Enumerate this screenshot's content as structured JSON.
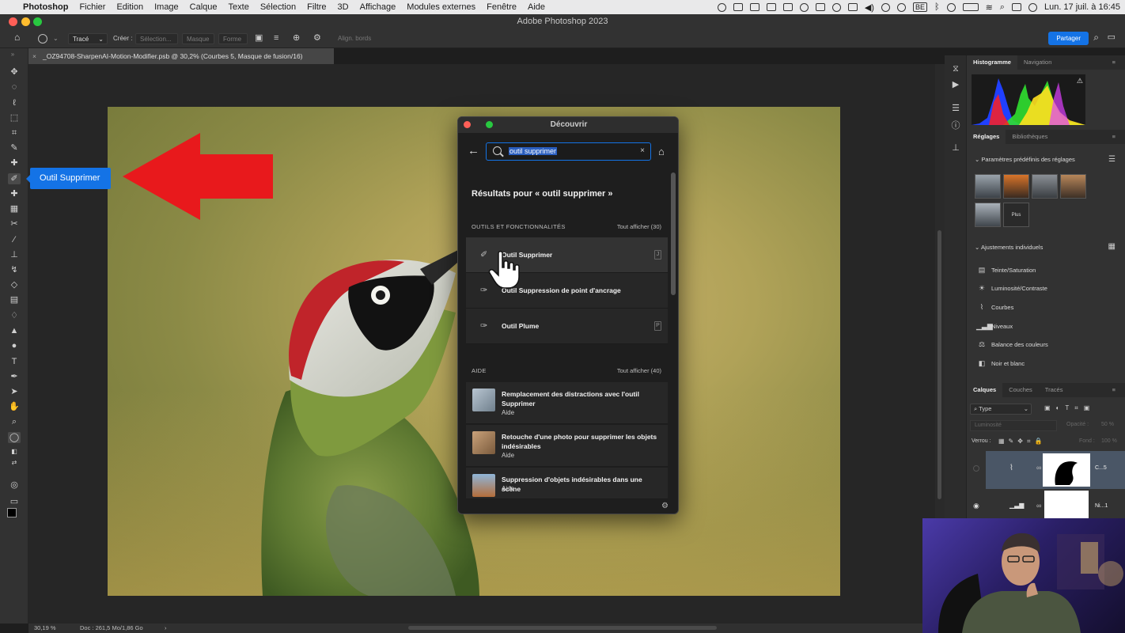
{
  "menubar": {
    "app": "Photoshop",
    "items": [
      "Fichier",
      "Edition",
      "Image",
      "Calque",
      "Texte",
      "Sélection",
      "Filtre",
      "3D",
      "Affichage",
      "Modules externes",
      "Fenêtre",
      "Aide"
    ],
    "lang_badge": "BE",
    "datetime": "Lun. 17 juil. à 16:45"
  },
  "window": {
    "title": "Adobe Photoshop 2023"
  },
  "options_bar": {
    "mode_value": "Tracé",
    "create_label": "Créer :",
    "selection_btn": "Sélection...",
    "mask_btn": "Masque",
    "shape_btn": "Forme",
    "align_label": "Align. bords",
    "share_label": "Partager"
  },
  "document": {
    "tab_title": "_OZ94708-SharpenAI-Motion-Modifier.psb @ 30,2% (Courbes 5, Masque de fusion/16)",
    "zoom": "30,19 %",
    "doc_info": "Doc : 261,5 Mo/1,86 Go"
  },
  "tooltip": {
    "text": "Outil Supprimer"
  },
  "discover": {
    "title": "Découvrir",
    "search_value": "outil supprimer",
    "results_heading": "Résultats pour « outil supprimer »",
    "tools_section": "OUTILS ET FONCTIONNALITÉS",
    "tools_show_all": "Tout afficher (30)",
    "tools": [
      {
        "label": "Outil Supprimer",
        "key": "J",
        "icon": "remove-tool-icon"
      },
      {
        "label": "Outil Suppression de point d'ancrage",
        "key": "",
        "icon": "delete-anchor-icon"
      },
      {
        "label": "Outil Plume",
        "key": "P",
        "icon": "pen-icon"
      }
    ],
    "help_section": "AIDE",
    "help_show_all": "Tout afficher (40)",
    "help": [
      {
        "title": "Remplacement des distractions avec l'outil Supprimer",
        "sub": "Aide"
      },
      {
        "title": "Retouche d'une photo pour supprimer les objets indésirables",
        "sub": "Aide"
      },
      {
        "title": "Suppression d'objets indésirables dans une scène",
        "sub": "Aide"
      }
    ]
  },
  "right_panel": {
    "top_tabs": [
      "Histogramme",
      "Navigation"
    ],
    "adj_tabs": [
      "Réglages",
      "Bibliothèques"
    ],
    "presets_label": "Paramètres prédéfinis des réglages",
    "more_label": "Plus",
    "individual_label": "Ajustements individuels",
    "adjustments": [
      "Teinte/Saturation",
      "Luminosité/Contraste",
      "Courbes",
      "Niveaux",
      "Balance des couleurs",
      "Noir et blanc"
    ],
    "layer_tabs": [
      "Calques",
      "Couches",
      "Tracés"
    ],
    "filter_type": "Type",
    "blend_mode": "Luminosité",
    "opacity_label": "Opacité :",
    "opacity_value": "50 %",
    "lock_label": "Verrou :",
    "fill_label": "Fond :",
    "fill_value": "100 %",
    "layers": [
      {
        "name": "C...5"
      },
      {
        "name": "Ni...1"
      }
    ]
  },
  "colors": {
    "accent": "#1473e6",
    "arrow": "#e8191c"
  }
}
